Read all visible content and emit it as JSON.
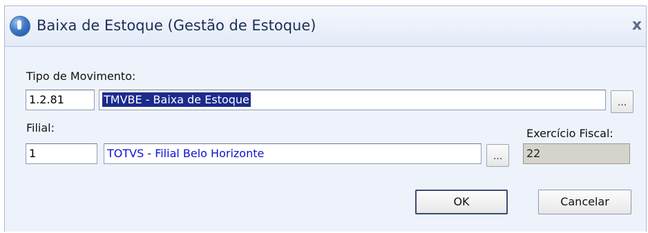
{
  "window": {
    "title": "Baixa de Estoque (Gestão de Estoque)",
    "close_glyph": "x",
    "app_icon": "info-globe-icon"
  },
  "tipo_movimento": {
    "label": "Tipo de Movimento:",
    "code": "1.2.81",
    "description": "TMVBE - Baixa de Estoque",
    "lookup_label": "..."
  },
  "filial": {
    "label": "Filial:",
    "code": "1",
    "description": "TOTVS - Filial Belo Horizonte",
    "lookup_label": "..."
  },
  "exercicio_fiscal": {
    "label": "Exercício Fiscal:",
    "value": "22"
  },
  "buttons": {
    "ok": "OK",
    "cancel": "Cancelar"
  },
  "colors": {
    "selection_bg": "#1b2b8c",
    "link_text": "#0b13d4",
    "readonly_bg": "#d6d3cc"
  }
}
